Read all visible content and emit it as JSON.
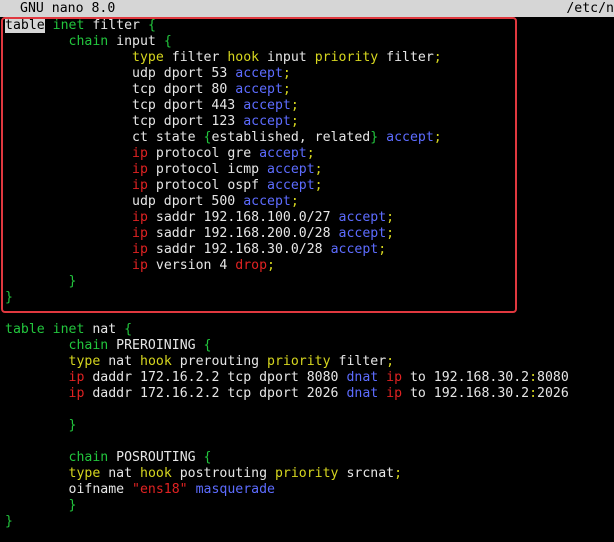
{
  "titlebar": {
    "app_name": "GNU nano 8.0",
    "file_path": "/etc/n"
  },
  "colors": {
    "keyword": "#22c53d",
    "type_keyword": "#d6d61f",
    "action": "#5d6cff",
    "drop": "#e02222",
    "highlight_box": "#e0383f",
    "titlebar_bg": "#d6d6d6"
  },
  "lines": [
    [
      {
        "t": "table",
        "c": "g"
      },
      {
        "t": " "
      },
      {
        "t": "inet",
        "c": "g"
      },
      {
        "t": " filter "
      },
      {
        "t": "{",
        "c": "g"
      }
    ],
    [
      {
        "t": "        "
      },
      {
        "t": "chain",
        "c": "g"
      },
      {
        "t": " input "
      },
      {
        "t": "{",
        "c": "g"
      }
    ],
    [
      {
        "t": "                "
      },
      {
        "t": "type",
        "c": "y"
      },
      {
        "t": " filter "
      },
      {
        "t": "hook",
        "c": "y"
      },
      {
        "t": " input "
      },
      {
        "t": "priority",
        "c": "y"
      },
      {
        "t": " filter"
      },
      {
        "t": ";",
        "c": "y"
      }
    ],
    [
      {
        "t": "                udp dport 53 "
      },
      {
        "t": "accept",
        "c": "b"
      },
      {
        "t": ";",
        "c": "y"
      }
    ],
    [
      {
        "t": "                tcp dport 80 "
      },
      {
        "t": "accept",
        "c": "b"
      },
      {
        "t": ";",
        "c": "y"
      }
    ],
    [
      {
        "t": "                tcp dport 443 "
      },
      {
        "t": "accept",
        "c": "b"
      },
      {
        "t": ";",
        "c": "y"
      }
    ],
    [
      {
        "t": "                tcp dport 123 "
      },
      {
        "t": "accept",
        "c": "b"
      },
      {
        "t": ";",
        "c": "y"
      }
    ],
    [
      {
        "t": "                ct state "
      },
      {
        "t": "{",
        "c": "g"
      },
      {
        "t": "established, related"
      },
      {
        "t": "}",
        "c": "g"
      },
      {
        "t": " "
      },
      {
        "t": "accept",
        "c": "b"
      },
      {
        "t": ";",
        "c": "y"
      }
    ],
    [
      {
        "t": "                "
      },
      {
        "t": "ip",
        "c": "r"
      },
      {
        "t": " protocol gre "
      },
      {
        "t": "accept",
        "c": "b"
      },
      {
        "t": ";",
        "c": "y"
      }
    ],
    [
      {
        "t": "                "
      },
      {
        "t": "ip",
        "c": "r"
      },
      {
        "t": " protocol icmp "
      },
      {
        "t": "accept",
        "c": "b"
      },
      {
        "t": ";",
        "c": "y"
      }
    ],
    [
      {
        "t": "                "
      },
      {
        "t": "ip",
        "c": "r"
      },
      {
        "t": " protocol ospf "
      },
      {
        "t": "accept",
        "c": "b"
      },
      {
        "t": ";",
        "c": "y"
      }
    ],
    [
      {
        "t": "                udp dport 500 "
      },
      {
        "t": "accept",
        "c": "b"
      },
      {
        "t": ";",
        "c": "y"
      }
    ],
    [
      {
        "t": "                "
      },
      {
        "t": "ip",
        "c": "r"
      },
      {
        "t": " saddr 192.168.100.0/27 "
      },
      {
        "t": "accept",
        "c": "b"
      },
      {
        "t": ";",
        "c": "y"
      }
    ],
    [
      {
        "t": "                "
      },
      {
        "t": "ip",
        "c": "r"
      },
      {
        "t": " saddr 192.168.200.0/28 "
      },
      {
        "t": "accept",
        "c": "b"
      },
      {
        "t": ";",
        "c": "y"
      }
    ],
    [
      {
        "t": "                "
      },
      {
        "t": "ip",
        "c": "r"
      },
      {
        "t": " saddr 192.168.30.0/28 "
      },
      {
        "t": "accept",
        "c": "b"
      },
      {
        "t": ";",
        "c": "y"
      }
    ],
    [
      {
        "t": "                "
      },
      {
        "t": "ip",
        "c": "r"
      },
      {
        "t": " version 4 "
      },
      {
        "t": "drop",
        "c": "r"
      },
      {
        "t": ";",
        "c": "y"
      }
    ],
    [
      {
        "t": "        "
      },
      {
        "t": "}",
        "c": "g"
      }
    ],
    [
      {
        "t": "}",
        "c": "g"
      }
    ],
    [],
    [
      {
        "t": "table",
        "c": "g"
      },
      {
        "t": " "
      },
      {
        "t": "inet",
        "c": "g"
      },
      {
        "t": " nat "
      },
      {
        "t": "{",
        "c": "g"
      }
    ],
    [
      {
        "t": "        "
      },
      {
        "t": "chain",
        "c": "g"
      },
      {
        "t": " PREROINING "
      },
      {
        "t": "{",
        "c": "g"
      }
    ],
    [
      {
        "t": "        "
      },
      {
        "t": "type",
        "c": "y"
      },
      {
        "t": " nat "
      },
      {
        "t": "hook",
        "c": "y"
      },
      {
        "t": " prerouting "
      },
      {
        "t": "priority",
        "c": "y"
      },
      {
        "t": " filter"
      },
      {
        "t": ";",
        "c": "y"
      }
    ],
    [
      {
        "t": "        "
      },
      {
        "t": "ip",
        "c": "r"
      },
      {
        "t": " daddr 172.16.2.2 tcp dport 8080 "
      },
      {
        "t": "dnat",
        "c": "b"
      },
      {
        "t": " "
      },
      {
        "t": "ip",
        "c": "r"
      },
      {
        "t": " to 192.168.30.2"
      },
      {
        "t": ":",
        "c": "y"
      },
      {
        "t": "8080"
      }
    ],
    [
      {
        "t": "        "
      },
      {
        "t": "ip",
        "c": "r"
      },
      {
        "t": " daddr 172.16.2.2 tcp dport 2026 "
      },
      {
        "t": "dnat",
        "c": "b"
      },
      {
        "t": " "
      },
      {
        "t": "ip",
        "c": "r"
      },
      {
        "t": " to 192.168.30.2"
      },
      {
        "t": ":",
        "c": "y"
      },
      {
        "t": "2026"
      }
    ],
    [],
    [
      {
        "t": "        "
      },
      {
        "t": "}",
        "c": "g"
      }
    ],
    [],
    [
      {
        "t": "        "
      },
      {
        "t": "chain",
        "c": "g"
      },
      {
        "t": " POSROUTING "
      },
      {
        "t": "{",
        "c": "g"
      }
    ],
    [
      {
        "t": "        "
      },
      {
        "t": "type",
        "c": "y"
      },
      {
        "t": " nat "
      },
      {
        "t": "hook",
        "c": "y"
      },
      {
        "t": " postrouting "
      },
      {
        "t": "priority",
        "c": "y"
      },
      {
        "t": " srcnat"
      },
      {
        "t": ";",
        "c": "y"
      }
    ],
    [
      {
        "t": "        oifname "
      },
      {
        "t": "\"ens18\"",
        "c": "r"
      },
      {
        "t": " "
      },
      {
        "t": "masquerade",
        "c": "b"
      }
    ],
    [
      {
        "t": "        "
      },
      {
        "t": "}",
        "c": "g"
      }
    ],
    [
      {
        "t": "}",
        "c": "g"
      }
    ]
  ]
}
